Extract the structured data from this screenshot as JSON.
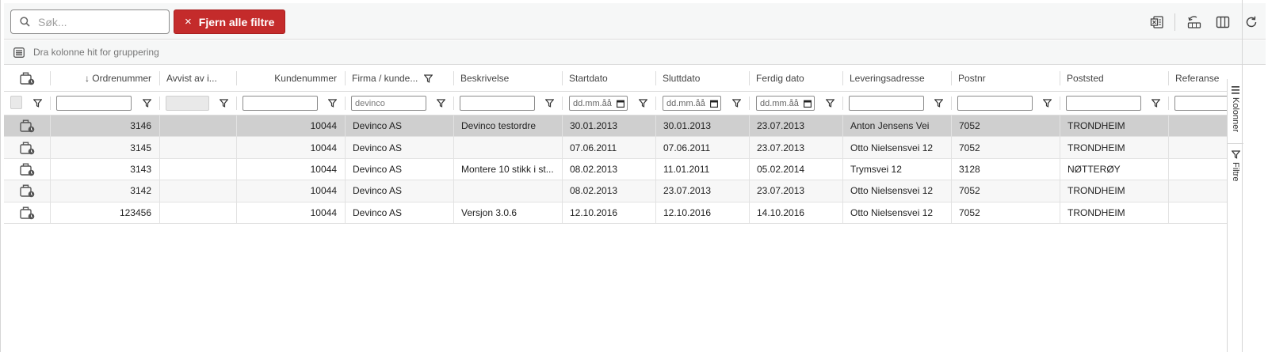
{
  "toolbar": {
    "search_placeholder": "Søk...",
    "clear_filters_label": "Fjern alle filtre",
    "clear_filters_icon": "×"
  },
  "grouping": {
    "hint": "Dra kolonne hit for gruppering"
  },
  "columns": [
    {
      "label": ""
    },
    {
      "label": "↓ Ordrenummer"
    },
    {
      "label": "Avvist av i..."
    },
    {
      "label": "Kundenummer"
    },
    {
      "label": "Firma / kunde..."
    },
    {
      "label": "Beskrivelse"
    },
    {
      "label": "Startdato"
    },
    {
      "label": "Sluttdato"
    },
    {
      "label": "Ferdig dato"
    },
    {
      "label": "Leveringsadresse"
    },
    {
      "label": "Postnr"
    },
    {
      "label": "Poststed"
    },
    {
      "label": "Referanse"
    }
  ],
  "filters": {
    "firma": "devinco",
    "date_placeholder": "dd.mm.åå"
  },
  "rows": [
    {
      "ordrenummer": "3146",
      "avvist": "",
      "kundenummer": "10044",
      "firma": "Devinco AS",
      "beskrivelse": "Devinco testordre",
      "startdato": "30.01.2013",
      "sluttdato": "30.01.2013",
      "ferdig": "23.07.2013",
      "adresse": "Anton Jensens Vei",
      "postnr": "7052",
      "poststed": "TRONDHEIM",
      "referanse": ""
    },
    {
      "ordrenummer": "3145",
      "avvist": "",
      "kundenummer": "10044",
      "firma": "Devinco AS",
      "beskrivelse": "",
      "startdato": "07.06.2011",
      "sluttdato": "07.06.2011",
      "ferdig": "23.07.2013",
      "adresse": "Otto Nielsensvei 12",
      "postnr": "7052",
      "poststed": "TRONDHEIM",
      "referanse": ""
    },
    {
      "ordrenummer": "3143",
      "avvist": "",
      "kundenummer": "10044",
      "firma": "Devinco AS",
      "beskrivelse": "Montere 10 stikk i st...",
      "startdato": "08.02.2013",
      "sluttdato": "11.01.2011",
      "ferdig": "05.02.2014",
      "adresse": "Trymsvei 12",
      "postnr": "3128",
      "poststed": "NØTTERØY",
      "referanse": ""
    },
    {
      "ordrenummer": "3142",
      "avvist": "",
      "kundenummer": "10044",
      "firma": "Devinco AS",
      "beskrivelse": "",
      "startdato": "08.02.2013",
      "sluttdato": "23.07.2013",
      "ferdig": "23.07.2013",
      "adresse": "Otto Nielsensvei 12",
      "postnr": "7052",
      "poststed": "TRONDHEIM",
      "referanse": ""
    },
    {
      "ordrenummer": "123456",
      "avvist": "",
      "kundenummer": "10044",
      "firma": "Devinco AS",
      "beskrivelse": "Versjon 3.0.6",
      "startdato": "12.10.2016",
      "sluttdato": "12.10.2016",
      "ferdig": "14.10.2016",
      "adresse": "Otto Nielsensvei 12",
      "postnr": "7052",
      "poststed": "TRONDHEIM",
      "referanse": ""
    }
  ],
  "side_panel": {
    "columns_tab": "Kolonner",
    "filters_tab": "Filtre"
  },
  "colors": {
    "danger": "#c42b2b",
    "selected_row": "#cfcfcf",
    "alt_row": "#f7f7f7"
  },
  "icons": [
    "search-icon",
    "excel-export-icon",
    "reset-layout-icon",
    "columns-icon",
    "refresh-icon",
    "group-icon",
    "filter-icon",
    "calendar-icon",
    "order-bag-icon"
  ]
}
